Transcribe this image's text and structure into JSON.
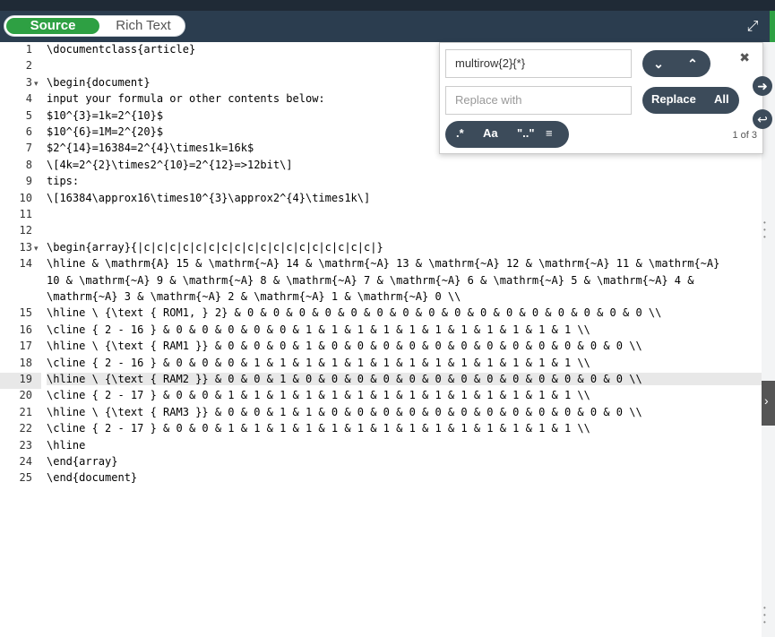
{
  "toolbar": {
    "source_label": "Source",
    "rich_label": "Rich Text",
    "expand_icon": "expand-icon"
  },
  "find": {
    "search_value": "multirow{2}{*}",
    "replace_placeholder": "Replace with",
    "replace_label": "Replace",
    "all_label": "All",
    "regex_label": ".*",
    "case_label": "Aa",
    "word_label": "\"..\"",
    "selection_icon": "align-left-icon",
    "count": "1 of 3",
    "close_icon": "close-icon",
    "next_icon": "chevron-down-icon",
    "prev_icon": "chevron-up-icon"
  },
  "editor": {
    "lines": [
      {
        "n": "1",
        "text": "\\documentclass{article}"
      },
      {
        "n": "2",
        "text": ""
      },
      {
        "n": "3",
        "text": "\\begin{document}",
        "fold": true
      },
      {
        "n": "4",
        "text": "input your formula or other contents below:"
      },
      {
        "n": "5",
        "text": "$10^{3}=1k=2^{10}$"
      },
      {
        "n": "6",
        "text": "$10^{6}=1M=2^{20}$"
      },
      {
        "n": "7",
        "text": "$2^{14}=16384=2^{4}\\times1k=16k$"
      },
      {
        "n": "8",
        "text": "\\[4k=2^{2}\\times2^{10}=2^{12}=>12bit\\]"
      },
      {
        "n": "9",
        "text": "tips:"
      },
      {
        "n": "10",
        "text": "\\[16384\\approx16\\times10^{3}\\approx2^{4}\\times1k\\]"
      },
      {
        "n": "11",
        "text": ""
      },
      {
        "n": "12",
        "text": ""
      },
      {
        "n": "13",
        "text": "\\begin{array}{|c|c|c|c|c|c|c|c|c|c|c|c|c|c|c|c|c|c|}",
        "fold": true
      },
      {
        "n": "14",
        "text": "\\hline & \\mathrm{A} 15 & \\mathrm{~A} 14 & \\mathrm{~A} 13 & \\mathrm{~A} 12 & \\mathrm{~A} 11 & \\mathrm{~A}"
      },
      {
        "n": "",
        "text": "10 & \\mathrm{~A} 9 & \\mathrm{~A} 8 & \\mathrm{~A} 7 & \\mathrm{~A} 6 & \\mathrm{~A} 5 & \\mathrm{~A} 4 &"
      },
      {
        "n": "",
        "text": "\\mathrm{~A} 3 & \\mathrm{~A} 2 & \\mathrm{~A} 1 & \\mathrm{~A} 0 \\\\"
      },
      {
        "n": "15",
        "text": "\\hline \\ {\\text { ROM1, } 2} & 0 & 0 & 0 & 0 & 0 & 0 & 0 & 0 & 0 & 0 & 0 & 0 & 0 & 0 & 0 & 0 \\\\"
      },
      {
        "n": "16",
        "text": "\\cline { 2 - 16 } & 0 & 0 & 0 & 0 & 0 & 1 & 1 & 1 & 1 & 1 & 1 & 1 & 1 & 1 & 1 & 1 \\\\"
      },
      {
        "n": "17",
        "text": "\\hline \\ {\\text { RAM1 }} & 0 & 0 & 0 & 1 & 0 & 0 & 0 & 0 & 0 & 0 & 0 & 0 & 0 & 0 & 0 & 0 \\\\"
      },
      {
        "n": "18",
        "text": "\\cline { 2 - 16 } & 0 & 0 & 0 & 1 & 1 & 1 & 1 & 1 & 1 & 1 & 1 & 1 & 1 & 1 & 1 & 1 \\\\"
      },
      {
        "n": "19",
        "text": "\\hline \\ {\\text { RAM2 }} & 0 & 0 & 1 & 0 & 0 & 0 & 0 & 0 & 0 & 0 & 0 & 0 & 0 & 0 & 0 & 0 \\\\",
        "active": true
      },
      {
        "n": "20",
        "text": "\\cline { 2 - 17 } & 0 & 0 & 1 & 1 & 1 & 1 & 1 & 1 & 1 & 1 & 1 & 1 & 1 & 1 & 1 & 1 \\\\"
      },
      {
        "n": "21",
        "text": "\\hline \\ {\\text { RAM3 }} & 0 & 0 & 1 & 1 & 0 & 0 & 0 & 0 & 0 & 0 & 0 & 0 & 0 & 0 & 0 & 0 \\\\"
      },
      {
        "n": "22",
        "text": "\\cline { 2 - 17 } & 0 & 0 & 1 & 1 & 1 & 1 & 1 & 1 & 1 & 1 & 1 & 1 & 1 & 1 & 1 & 1 \\\\"
      },
      {
        "n": "23",
        "text": "\\hline"
      },
      {
        "n": "24",
        "text": "\\end{array}"
      },
      {
        "n": "25",
        "text": "\\end{document}"
      }
    ]
  },
  "colors": {
    "toolbar": "#2b3d4f",
    "accent_green": "#2ea043",
    "pill": "#3c4b5a"
  }
}
